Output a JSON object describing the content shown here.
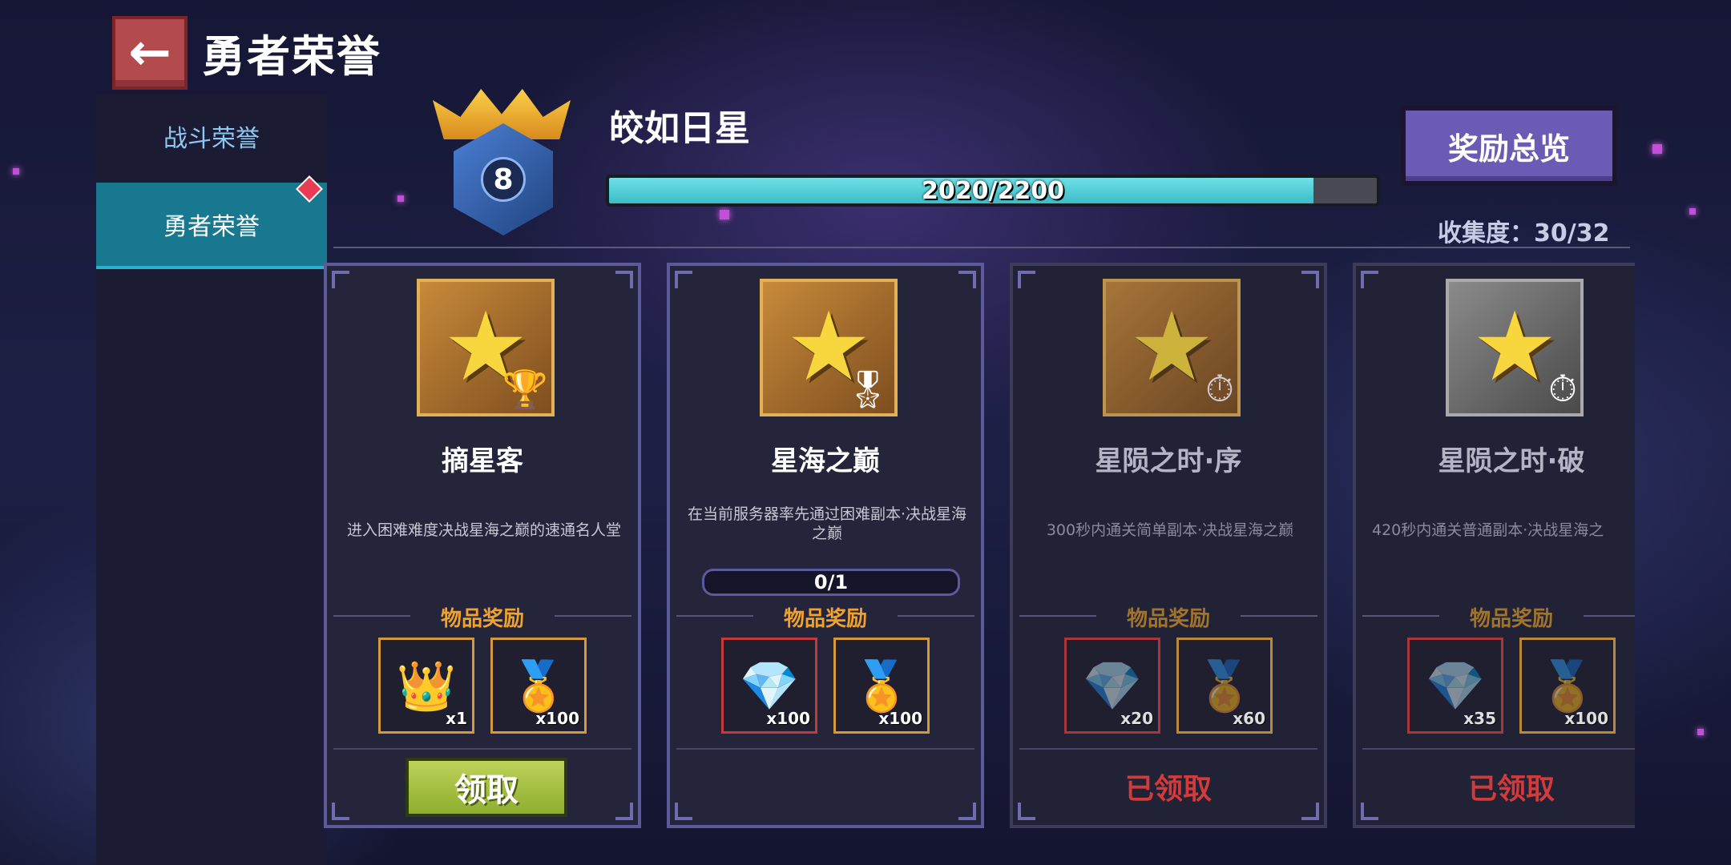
{
  "header": {
    "back_icon": "arrow-left-icon",
    "title": "勇者荣誉"
  },
  "sidebar": {
    "items": [
      {
        "label": "战斗荣誉",
        "active": false
      },
      {
        "label": "勇者荣誉",
        "active": true
      }
    ]
  },
  "rank": {
    "level": "8",
    "name": "皎如日星",
    "progress_text": "2020/2200",
    "progress_fraction": 0.918
  },
  "overview_button": "奖励总览",
  "collection": "收集度：30/32",
  "cards": [
    {
      "name": "摘星客",
      "desc": "进入困难难度决战星海之巅的速通名人堂",
      "progress": "",
      "reward_title": "物品奖励",
      "rewards": [
        {
          "icon": "mask-item-icon",
          "qty": "x1"
        },
        {
          "icon": "star-coin-icon",
          "qty": "x100"
        }
      ],
      "status": "claim",
      "claim_label": "领取"
    },
    {
      "name": "星海之巅",
      "desc": "在当前服务器率先通过困难副本·决战星海之巅",
      "progress": "0/1",
      "reward_title": "物品奖励",
      "rewards": [
        {
          "icon": "gem-icon",
          "qty": "x100"
        },
        {
          "icon": "star-coin-icon",
          "qty": "x100"
        }
      ],
      "status": "none"
    },
    {
      "name": "星陨之时·序",
      "desc": "300秒内通关简单副本·决战星海之巅",
      "progress": "",
      "reward_title": "物品奖励",
      "rewards": [
        {
          "icon": "gem-icon",
          "qty": "x20"
        },
        {
          "icon": "star-coin-icon",
          "qty": "x60"
        }
      ],
      "status": "claimed",
      "claimed_label": "已领取"
    },
    {
      "name": "星陨之时·破",
      "desc": "420秒内通关普通副本·决战星海之",
      "progress": "",
      "reward_title": "物品奖励",
      "rewards": [
        {
          "icon": "gem-icon",
          "qty": "x35"
        },
        {
          "icon": "star-coin-icon",
          "qty": "x100"
        }
      ],
      "status": "claimed",
      "claimed_label": "已领取"
    }
  ]
}
